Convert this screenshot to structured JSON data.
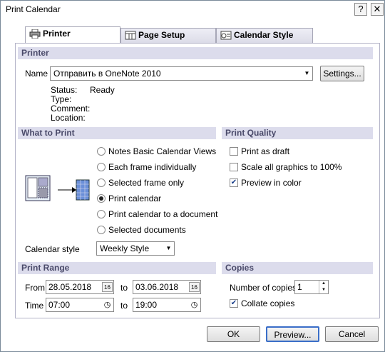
{
  "window": {
    "title": "Print Calendar",
    "help_label": "?",
    "close_label": "✕"
  },
  "tabs": [
    {
      "label": "Printer"
    },
    {
      "label": "Page Setup"
    },
    {
      "label": "Calendar Style"
    }
  ],
  "printer": {
    "section_title": "Printer",
    "name_label": "Name",
    "name_value": "Отправить в OneNote 2010",
    "settings_label": "Settings...",
    "status_label": "Status:",
    "status_value": "Ready",
    "type_label": "Type:",
    "comment_label": "Comment:",
    "location_label": "Location:"
  },
  "what_to_print": {
    "section_title": "What to Print",
    "options": [
      {
        "label": "Notes Basic Calendar Views",
        "selected": false
      },
      {
        "label": "Each frame individually",
        "selected": false
      },
      {
        "label": "Selected frame only",
        "selected": false
      },
      {
        "label": "Print calendar",
        "selected": true
      },
      {
        "label": "Print calendar to a document",
        "selected": false
      },
      {
        "label": "Selected documents",
        "selected": false
      }
    ],
    "calendar_style_label": "Calendar style",
    "calendar_style_value": "Weekly Style"
  },
  "print_quality": {
    "section_title": "Print Quality",
    "options": [
      {
        "label": "Print as draft",
        "checked": false
      },
      {
        "label": "Scale all graphics to 100%",
        "checked": false
      },
      {
        "label": "Preview in color",
        "checked": true
      }
    ]
  },
  "print_range": {
    "section_title": "Print Range",
    "from_label": "From",
    "from_value": "28.05.2018",
    "to_label_1": "to",
    "to_date_value": "03.06.2018",
    "time_label": "Time",
    "time_from_value": "07:00",
    "to_label_2": "to",
    "time_to_value": "19:00",
    "date_picker_label": "16"
  },
  "copies": {
    "section_title": "Copies",
    "number_label": "Number of copies",
    "number_value": "1",
    "collate_label": "Collate copies",
    "collate_checked": true
  },
  "buttons": {
    "ok": "OK",
    "preview": "Preview...",
    "cancel": "Cancel"
  }
}
